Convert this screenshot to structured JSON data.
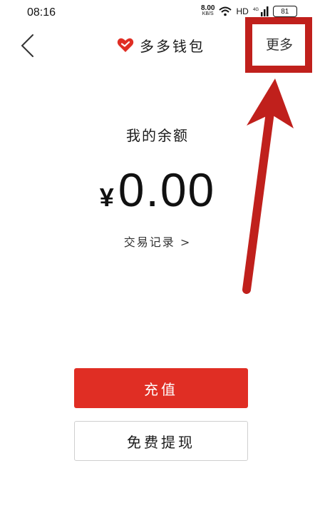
{
  "status_bar": {
    "time": "08:16",
    "net_speed_value": "8.00",
    "net_speed_unit": "KB/S",
    "network_label": "HD",
    "signal_label": "4G",
    "battery_level": "81"
  },
  "header": {
    "title": "多多钱包",
    "more_label": "更多"
  },
  "balance": {
    "label": "我的余额",
    "currency": "¥",
    "amount": "0.00"
  },
  "transactions_link": "交易记录 >",
  "actions": {
    "recharge_label": "充值",
    "withdraw_label": "免费提现"
  },
  "colors": {
    "brand_red": "#e02e24",
    "annotation_red": "#c0201c"
  },
  "icons": {
    "back": "chevron-left-icon",
    "logo": "heart-icon",
    "wifi": "wifi-icon",
    "signal": "signal-icon",
    "battery": "battery-icon"
  }
}
